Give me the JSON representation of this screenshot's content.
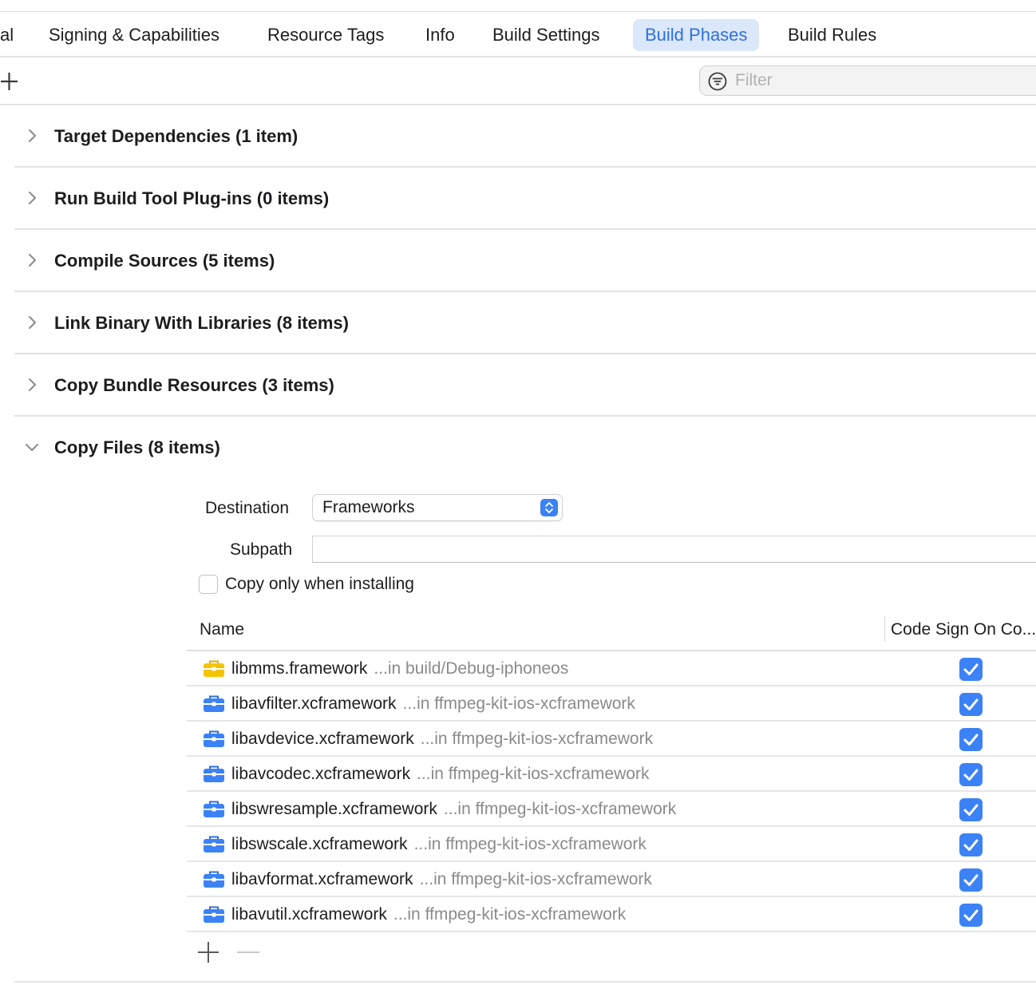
{
  "tabs": [
    {
      "label": "al"
    },
    {
      "label": "Signing & Capabilities"
    },
    {
      "label": "Resource Tags"
    },
    {
      "label": "Info"
    },
    {
      "label": "Build Settings"
    },
    {
      "label": "Build Phases",
      "active": true
    },
    {
      "label": "Build Rules"
    }
  ],
  "filter": {
    "placeholder": "Filter"
  },
  "phases": [
    {
      "title": "Target Dependencies (1 item)",
      "expanded": false
    },
    {
      "title": "Run Build Tool Plug-ins (0 items)",
      "expanded": false
    },
    {
      "title": "Compile Sources (5 items)",
      "expanded": false
    },
    {
      "title": "Link Binary With Libraries (8 items)",
      "expanded": false
    },
    {
      "title": "Copy Bundle Resources (3 items)",
      "expanded": false
    },
    {
      "title": "Copy Files (8 items)",
      "expanded": true
    }
  ],
  "copy_files": {
    "destination_label": "Destination",
    "destination_value": "Frameworks",
    "subpath_label": "Subpath",
    "subpath_value": "",
    "install_label": "Copy only when installing",
    "install_checked": false,
    "columns": {
      "name": "Name",
      "code_sign": "Code Sign On Co..."
    },
    "rows": [
      {
        "name": "libmms.framework",
        "path": "...in build/Debug-iphoneos",
        "icon": "framework-yellow-icon",
        "code_sign": true
      },
      {
        "name": "libavfilter.xcframework",
        "path": "...in ffmpeg-kit-ios-xcframework",
        "icon": "xcframework-blue-icon",
        "code_sign": true
      },
      {
        "name": "libavdevice.xcframework",
        "path": "...in ffmpeg-kit-ios-xcframework",
        "icon": "xcframework-blue-icon",
        "code_sign": true
      },
      {
        "name": "libavcodec.xcframework",
        "path": "...in ffmpeg-kit-ios-xcframework",
        "icon": "xcframework-blue-icon",
        "code_sign": true
      },
      {
        "name": "libswresample.xcframework",
        "path": "...in ffmpeg-kit-ios-xcframework",
        "icon": "xcframework-blue-icon",
        "code_sign": true
      },
      {
        "name": "libswscale.xcframework",
        "path": "...in ffmpeg-kit-ios-xcframework",
        "icon": "xcframework-blue-icon",
        "code_sign": true
      },
      {
        "name": "libavformat.xcframework",
        "path": "...in ffmpeg-kit-ios-xcframework",
        "icon": "xcframework-blue-icon",
        "code_sign": true
      },
      {
        "name": "libavutil.xcframework",
        "path": "...in ffmpeg-kit-ios-xcframework",
        "icon": "xcframework-blue-icon",
        "code_sign": true
      }
    ]
  },
  "colors": {
    "accent": "#3b82f6",
    "active_tab_bg": "#dbe8fb",
    "active_tab_text": "#2f6fe0",
    "framework_yellow": "#f5c400",
    "xcframework_blue": "#3b82f6"
  }
}
